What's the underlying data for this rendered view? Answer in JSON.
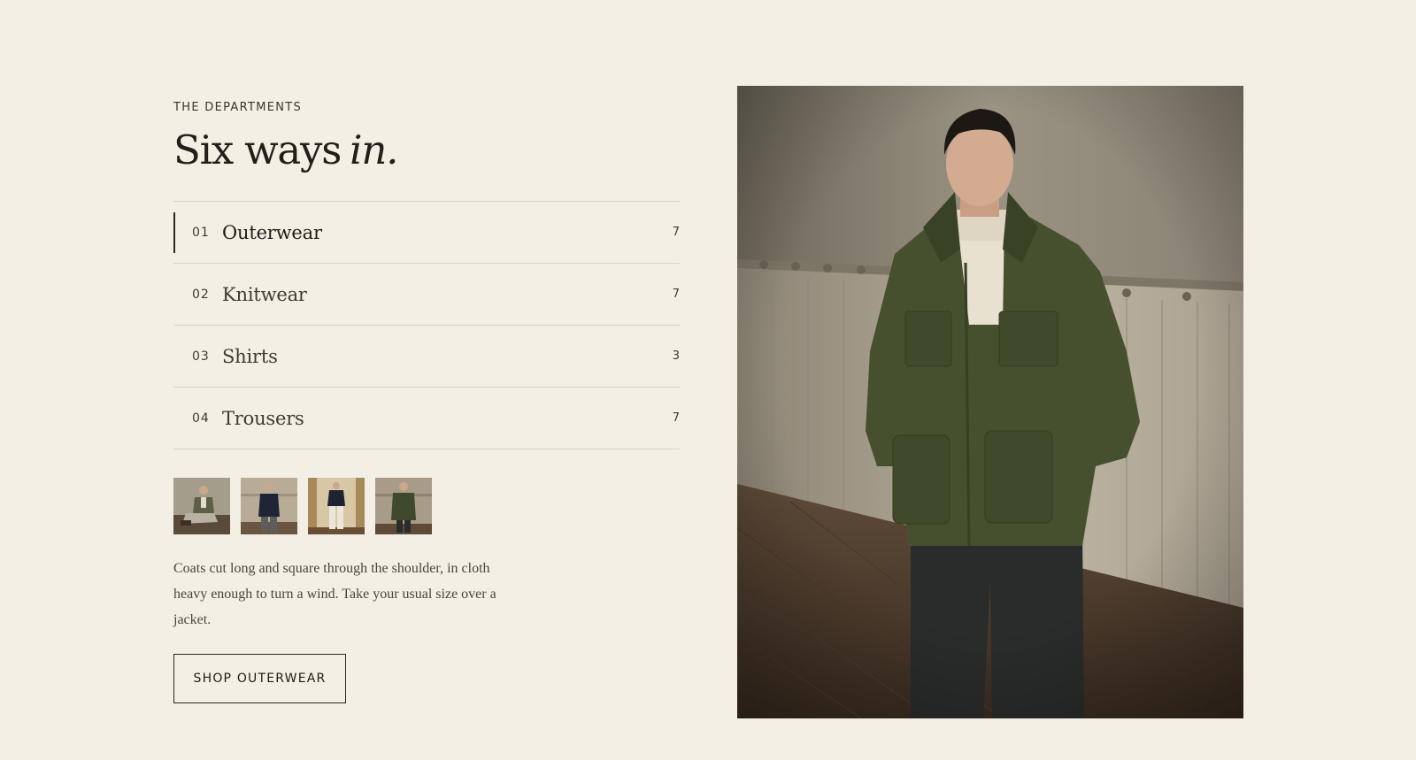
{
  "departments": {
    "eyebrow": "THE DEPARTMENTS",
    "heading_main": "Six ways",
    "heading_em": "in.",
    "items": [
      {
        "number": "01",
        "name": "Outerwear",
        "count": "7",
        "active": true
      },
      {
        "number": "02",
        "name": "Knitwear",
        "count": "7",
        "active": false
      },
      {
        "number": "03",
        "name": "Shirts",
        "count": "3",
        "active": false
      },
      {
        "number": "04",
        "name": "Trousers",
        "count": "7",
        "active": false
      }
    ],
    "thumbnails": [
      {
        "icon": "seated-model-thumbnail",
        "jacket_color": "#5b5f44"
      },
      {
        "icon": "navy-jacket-thumbnail",
        "jacket_color": "#1f2536"
      },
      {
        "icon": "navy-jacket-white-trousers-thumbnail",
        "jacket_color": "#1e2333"
      },
      {
        "icon": "olive-jacket-thumbnail",
        "jacket_color": "#3f4a2d"
      }
    ],
    "description": "Coats cut long and square through the shoulder, in cloth heavy enough to turn a wind. Take your usual size over a jacket.",
    "cta_label": "SHOP OUTERWEAR"
  },
  "hero_image": {
    "icon": "model-in-olive-field-jacket-photo",
    "jacket_color": "#46502f",
    "sweater_color": "#e8e1cf",
    "trouser_color": "#2a2b2b"
  },
  "colors": {
    "background": "#f4efe4",
    "text": "#2b2721",
    "divider": "#d8d1c3"
  }
}
